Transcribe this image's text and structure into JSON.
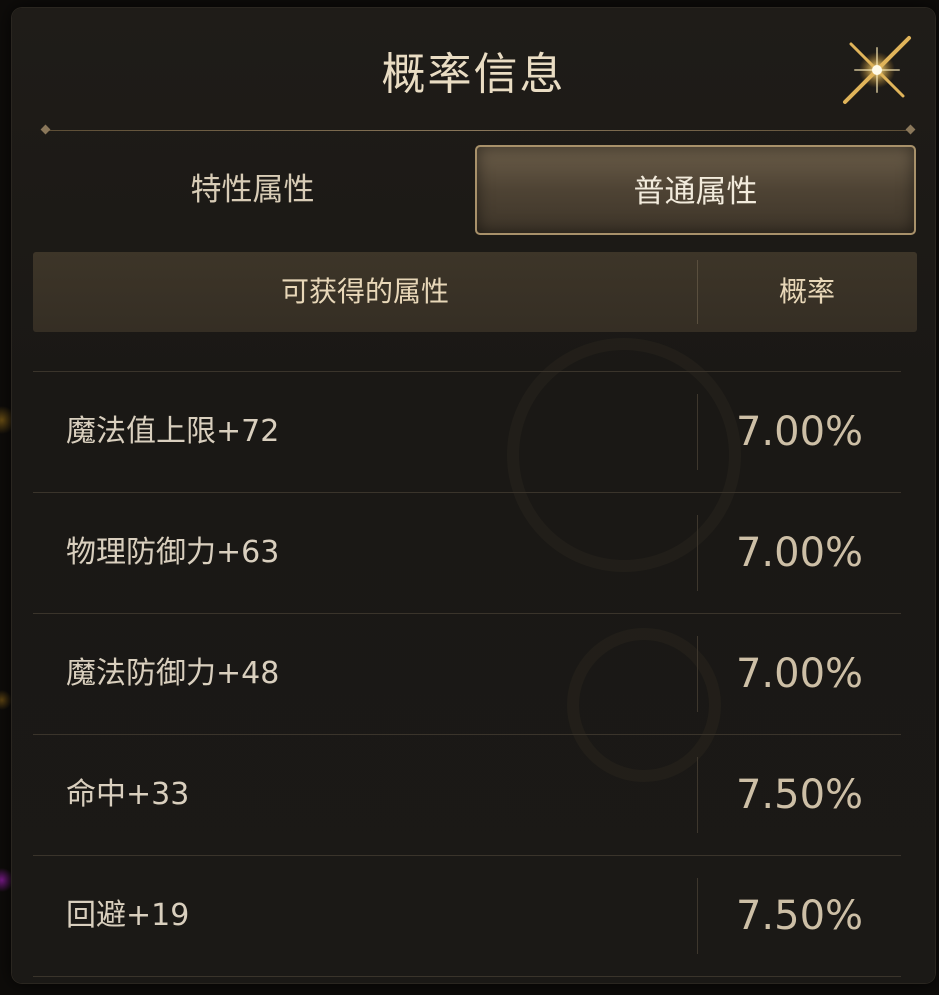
{
  "dialog": {
    "title": "概率信息",
    "close_icon": "close-x-icon"
  },
  "tabs": [
    {
      "label": "特性属性",
      "active": false
    },
    {
      "label": "普通属性",
      "active": true
    }
  ],
  "table": {
    "headers": {
      "attribute": "可获得的属性",
      "probability": "概率"
    },
    "rows": [
      {
        "attribute": "魔法值上限+72",
        "probability": "7.00%"
      },
      {
        "attribute": "物理防御力+63",
        "probability": "7.00%"
      },
      {
        "attribute": "魔法防御力+48",
        "probability": "7.00%"
      },
      {
        "attribute": "命中+33",
        "probability": "7.50%"
      },
      {
        "attribute": "回避+19",
        "probability": "7.50%"
      }
    ]
  },
  "colors": {
    "panel_bg": "#1c1a16",
    "title_text": "#e9dcc3",
    "accent_gold": "#a8916a",
    "header_bg": "#3a3227"
  }
}
